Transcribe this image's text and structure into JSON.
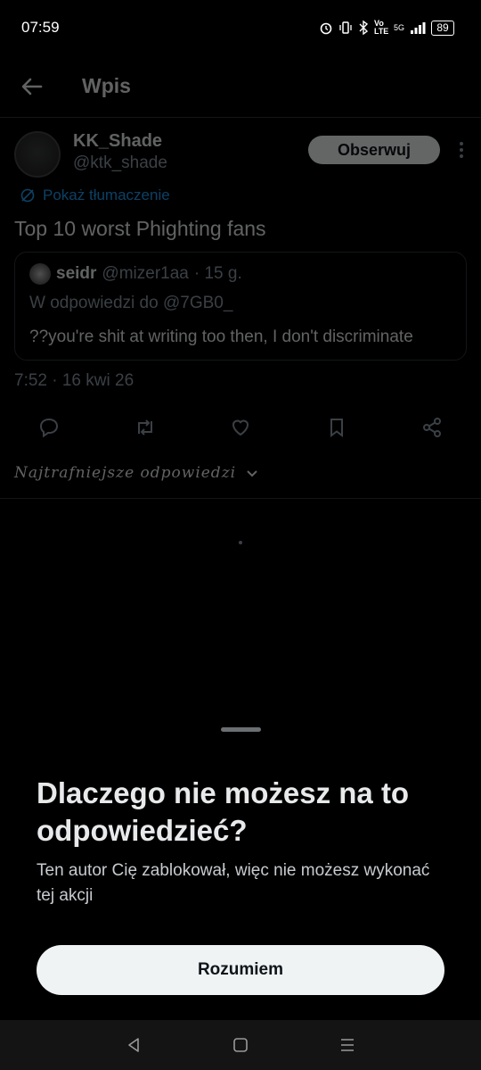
{
  "status_bar": {
    "time": "07:59",
    "network": "5G",
    "volte": "Vo LTE",
    "battery": "89"
  },
  "header": {
    "title": "Wpis"
  },
  "tweet": {
    "author_name": "KK_Shade",
    "author_handle": "@ktk_shade",
    "follow_label": "Obserwuj",
    "translate_label": "Pokaż tłumaczenie",
    "text": "Top 10 worst Phighting fans",
    "timestamp": "7:52 · 16 kwi 26",
    "quote": {
      "name": "seidr",
      "handle": "@mizer1aa",
      "age": "· 15 g.",
      "reply_to": "W odpowiedzi do @7GB0_",
      "text": "??you're shit at writing too then, I don't discriminate"
    }
  },
  "replies": {
    "sort_label": "Najtrafniejsze odpowiedzi"
  },
  "sheet": {
    "title": "Dlaczego nie możesz na to odpowiedzieć?",
    "description": "Ten autor Cię zablokował, więc nie możesz wykonać tej akcji",
    "button_label": "Rozumiem"
  },
  "colors": {
    "link": "#1d9bf0",
    "muted": "#8b98a5",
    "border": "#2f3336"
  }
}
